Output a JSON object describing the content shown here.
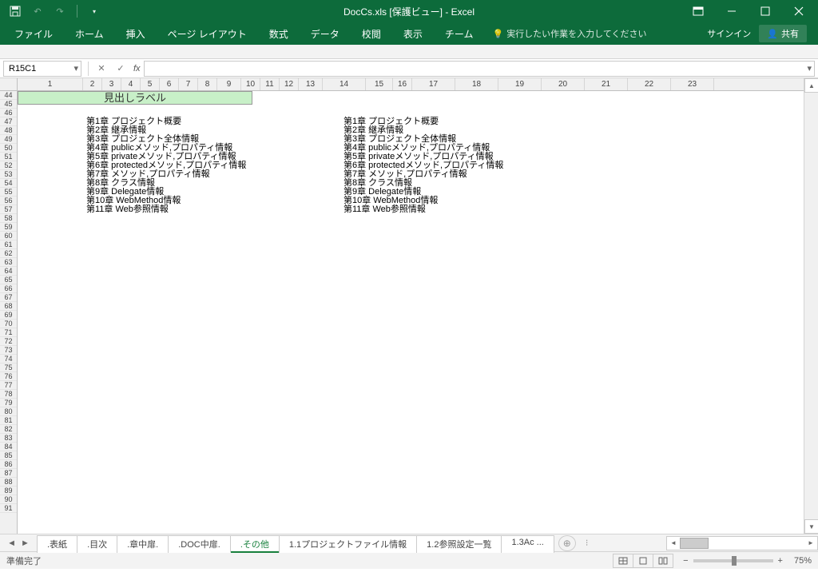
{
  "title": "DocCs.xls  [保護ビュー]  - Excel",
  "qat": {
    "save": "💾"
  },
  "tabs": {
    "file": "ファイル",
    "home": "ホーム",
    "insert": "挿入",
    "layout": "ページ レイアウト",
    "formula": "数式",
    "data": "データ",
    "review": "校閲",
    "view": "表示",
    "team": "チーム"
  },
  "tellme": "実行したい作業を入力してください",
  "signin": "サインイン",
  "share": "共有",
  "namebox": "R15C1",
  "cols": [
    "1",
    "2",
    "3",
    "4",
    "5",
    "6",
    "7",
    "8",
    "9",
    "10",
    "11",
    "12",
    "13",
    "14",
    "15",
    "16",
    "17",
    "18",
    "19",
    "20",
    "21",
    "22",
    "23"
  ],
  "rows": [
    "44",
    "45",
    "46",
    "47",
    "48",
    "49",
    "50",
    "51",
    "52",
    "53",
    "54",
    "55",
    "56",
    "57",
    "58",
    "59",
    "60",
    "61",
    "62",
    "63",
    "64",
    "65",
    "66",
    "67",
    "68",
    "69",
    "70",
    "71",
    "72",
    "73",
    "74",
    "75",
    "76",
    "77",
    "78",
    "79",
    "80",
    "81",
    "82",
    "83",
    "84",
    "85",
    "86",
    "87",
    "88",
    "89",
    "90",
    "91"
  ],
  "heading": "見出しラベル",
  "listA": [
    "第1章 プロジェクト概要",
    "第2章 継承情報",
    "第3章 プロジェクト全体情報",
    "第4章 publicメソッド,プロパティ情報",
    "第5章 privateメソッド,プロパティ情報",
    "第6章 protectedメソッド,プロパティ情報",
    "第7章 メソッド,プロパティ情報",
    "第8章 クラス情報",
    "第9章 Delegate情報",
    "第10章 WebMethod情報",
    "第11章 Web参照情報"
  ],
  "listB": [
    "第1章 プロジェクト概要",
    "第2章 継承情報",
    "第3章 プロジェクト全体情報",
    "第4章 publicメソッド,プロパティ情報",
    "第5章 privateメソッド,プロパティ情報",
    "第6章 protectedメソッド,プロパティ情報",
    "第7章 メソッド,プロパティ情報",
    "第8章 クラス情報",
    "第9章 Delegate情報",
    "第10章 WebMethod情報",
    "第11章 Web参照情報"
  ],
  "sheets": [
    ".表紙",
    ".目次",
    ".章中扉.",
    ".DOC中扉.",
    ".その他",
    "1.1プロジェクトファイル情報",
    "1.2参照設定一覧",
    "1.3Ac  ..."
  ],
  "activeSheet": 4,
  "status": "準備完了",
  "zoom": "75%"
}
